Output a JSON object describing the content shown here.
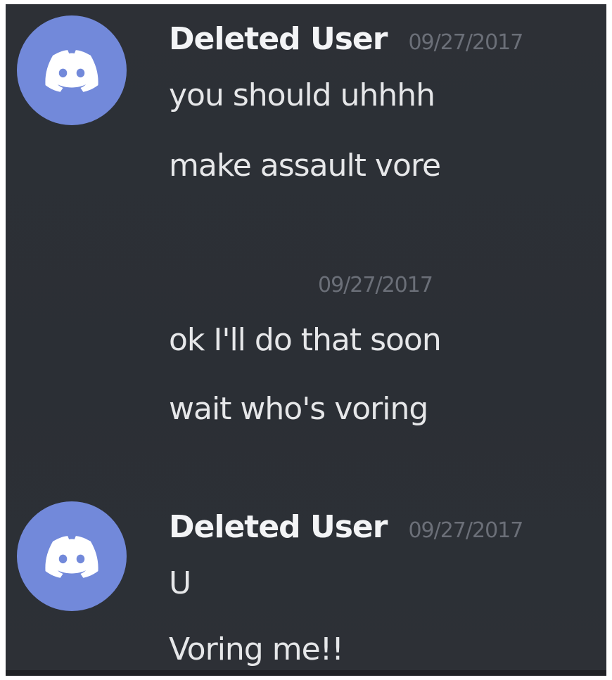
{
  "messages": [
    {
      "username": "Deleted User",
      "timestamp": "09/27/2017",
      "lines": [
        "you should uhhhh",
        "make assault vore"
      ]
    },
    {
      "timestamp": "09/27/2017",
      "lines": [
        "ok I'll do that soon",
        "wait who's voring"
      ]
    },
    {
      "username": "Deleted User",
      "timestamp": "09/27/2017",
      "lines": [
        "U",
        "Voring me!!"
      ]
    }
  ],
  "avatar_icon": "discord-logo-icon",
  "colors": {
    "background": "#2f3136",
    "avatar": "#7289da",
    "username": "#f3f4f6",
    "text": "#e6e7e9",
    "timestamp": "#6b6f78"
  }
}
